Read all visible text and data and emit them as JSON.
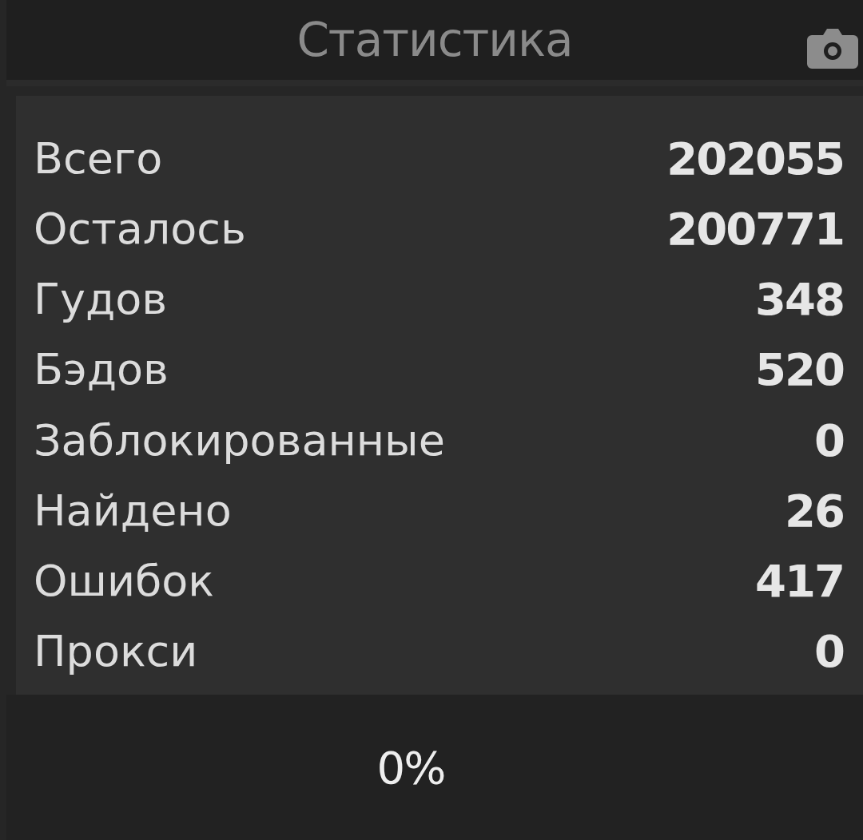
{
  "header": {
    "title": "Статистика"
  },
  "stats": [
    {
      "label": "Всего",
      "value": "202055"
    },
    {
      "label": "Осталось",
      "value": "200771"
    },
    {
      "label": "Гудов",
      "value": "348"
    },
    {
      "label": "Бэдов",
      "value": "520"
    },
    {
      "label": "Заблокированные",
      "value": "0"
    },
    {
      "label": "Найдено",
      "value": "26"
    },
    {
      "label": "Ошибок",
      "value": "417"
    },
    {
      "label": "Прокси",
      "value": "0"
    }
  ],
  "progress": {
    "text": "0%"
  }
}
